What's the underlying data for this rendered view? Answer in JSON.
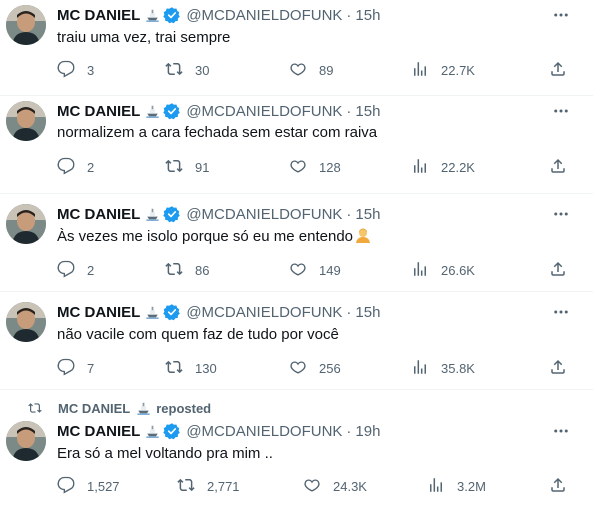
{
  "author": {
    "name": "MC DANIEL",
    "handle": "@MCDANIELDOFUNK"
  },
  "tweets": [
    {
      "time": "15h",
      "text": "traiu uma vez, trai sempre",
      "replies": "3",
      "reposts": "30",
      "likes": "89",
      "views": "22.7K"
    },
    {
      "time": "15h",
      "text": "normalizem a cara fechada sem estar com raiva",
      "replies": "2",
      "reposts": "91",
      "likes": "128",
      "views": "22.2K"
    },
    {
      "time": "15h",
      "text": "Às vezes me isolo porque só eu me entendo",
      "replies": "2",
      "reposts": "86",
      "likes": "149",
      "views": "26.6K"
    },
    {
      "time": "15h",
      "text": "não vacile com quem faz de tudo por você",
      "replies": "7",
      "reposts": "130",
      "likes": "256",
      "views": "35.8K"
    },
    {
      "time": "19h",
      "text": "Era só a mel voltando pra mim ..",
      "replies": "1,527",
      "reposts": "2,771",
      "likes": "24.3K",
      "views": "3.2M"
    }
  ],
  "repost_banner": {
    "name": "MC DANIEL",
    "label": "reposted"
  },
  "separator": "·",
  "icons": {
    "reply": "reply-icon",
    "repost": "repost-icon",
    "like": "heart-icon",
    "views": "views-icon",
    "share": "share-icon",
    "more": "more-icon",
    "verified": "verified-badge-icon",
    "name_emoji": "ship-emoji-icon",
    "tweet3_emoji": "person-emoji-icon"
  },
  "colors": {
    "text": "#0f1419",
    "secondary": "#536471",
    "verified": "#1d9bf0",
    "divider": "#eff3f4"
  }
}
